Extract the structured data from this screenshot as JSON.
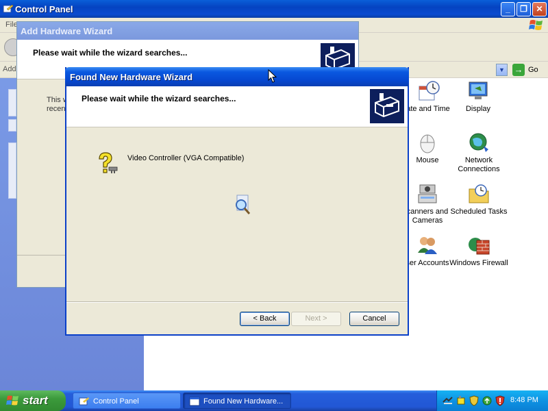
{
  "control_panel": {
    "title": "Control Panel",
    "menu_partial": "File",
    "address_partial": "Addr",
    "go_label": "Go",
    "icons": [
      {
        "label": "ate and Time",
        "icon": "date-time-icon"
      },
      {
        "label": "Display",
        "icon": "display-icon"
      },
      {
        "label": "Mouse",
        "icon": "mouse-icon"
      },
      {
        "label": "Network Connections",
        "icon": "network-icon"
      },
      {
        "label": "canners and Cameras",
        "icon": "scanner-camera-icon"
      },
      {
        "label": "Scheduled Tasks",
        "icon": "scheduled-tasks-icon"
      },
      {
        "label": "ser Accounts",
        "icon": "user-accounts-icon"
      },
      {
        "label": "Windows Firewall",
        "icon": "firewall-icon"
      }
    ]
  },
  "add_hardware_wizard": {
    "title": "Add Hardware Wizard",
    "heading": "Please wait while the wizard searches...",
    "body_partial_1": "This w",
    "body_partial_2": "recen"
  },
  "found_new_hardware_wizard": {
    "title": "Found New Hardware Wizard",
    "heading": "Please wait while the wizard searches...",
    "device_name": "Video Controller (VGA Compatible)",
    "back_label": "< Back",
    "next_label": "Next >",
    "cancel_label": "Cancel"
  },
  "taskbar": {
    "start_label": "start",
    "tasks": [
      {
        "label": "Control Panel",
        "active": false
      },
      {
        "label": "Found New Hardware...",
        "active": true
      }
    ],
    "clock": "8:48 PM"
  },
  "colors": {
    "xp_blue": "#0a58e0",
    "dialog_bg": "#ece9d8",
    "start_green": "#3c9a3c",
    "tray_blue": "#0f92e2"
  }
}
